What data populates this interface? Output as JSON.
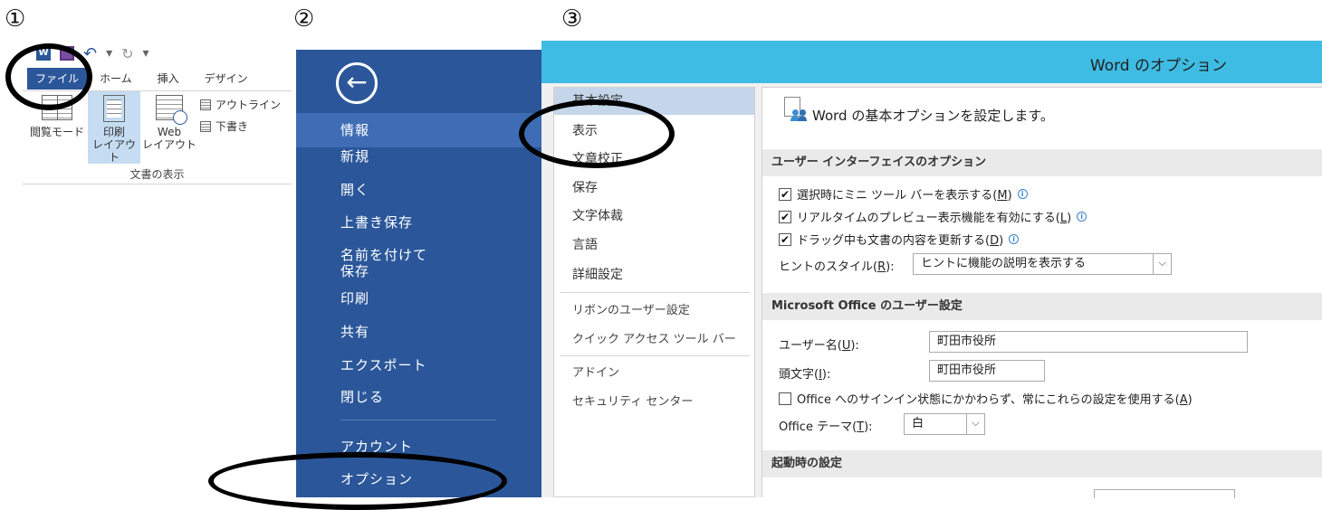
{
  "steps": [
    "①",
    "②",
    "③"
  ],
  "ribbon": {
    "tabs": [
      "ファイル",
      "ホーム",
      "挿入",
      "デザイン"
    ],
    "buttons": {
      "read_mode": "閲覧モード",
      "print_layout_1": "印刷",
      "print_layout_2": "レイアウト",
      "web_layout_1": "Web",
      "web_layout_2": "レイアウト",
      "outline": "アウトライン",
      "draft": "下書き"
    },
    "group_label": "文書の表示",
    "qat_redo": "↻",
    "qat_more": "▾"
  },
  "backstage": {
    "back_icon": "←",
    "items": [
      "情報",
      "新規",
      "開く",
      "上書き保存",
      "名前を付けて",
      "保存",
      "印刷",
      "共有",
      "エクスポート",
      "閉じる",
      "アカウント",
      "オプション"
    ]
  },
  "options": {
    "title": "Word のオプション",
    "nav": [
      "基本設定",
      "表示",
      "文章校正",
      "保存",
      "文字体裁",
      "言語",
      "詳細設定",
      "リボンのユーザー設定",
      "クイック アクセス ツール バー",
      "アドイン",
      "セキュリティ センター"
    ],
    "header": "Word の基本オプションを設定します。",
    "sections": {
      "ui": "ユーザー インターフェイスのオプション",
      "user": "Microsoft Office のユーザー設定",
      "startup": "起動時の設定"
    },
    "checkboxes": [
      {
        "text": "選択時にミニ ツール バーを表示する(",
        "key": "M",
        "checked": true
      },
      {
        "text": "リアルタイムのプレビュー表示機能を有効にする(",
        "key": "L",
        "checked": true
      },
      {
        "text": "ドラッグ中も文書の内容を更新する(",
        "key": "D",
        "checked": true
      }
    ],
    "hint_style": {
      "label": "ヒントのスタイル(",
      "key": "R",
      "value": "ヒントに機能の説明を表示する"
    },
    "username": {
      "label": "ユーザー名(",
      "key": "U",
      "value": "町田市役所"
    },
    "initials": {
      "label": "頭文字(",
      "key": "I",
      "value": "町田市役所"
    },
    "always_use": {
      "text": "Office へのサインイン状態にかかわらず、常にこれらの設定を使用する(",
      "key": "A",
      "checked": false
    },
    "theme": {
      "label": "Office テーマ(",
      "key": "T",
      "value": "白"
    },
    "dropdown_icon": "⌵",
    "info_icon": "i",
    "check_mark": "✔"
  }
}
